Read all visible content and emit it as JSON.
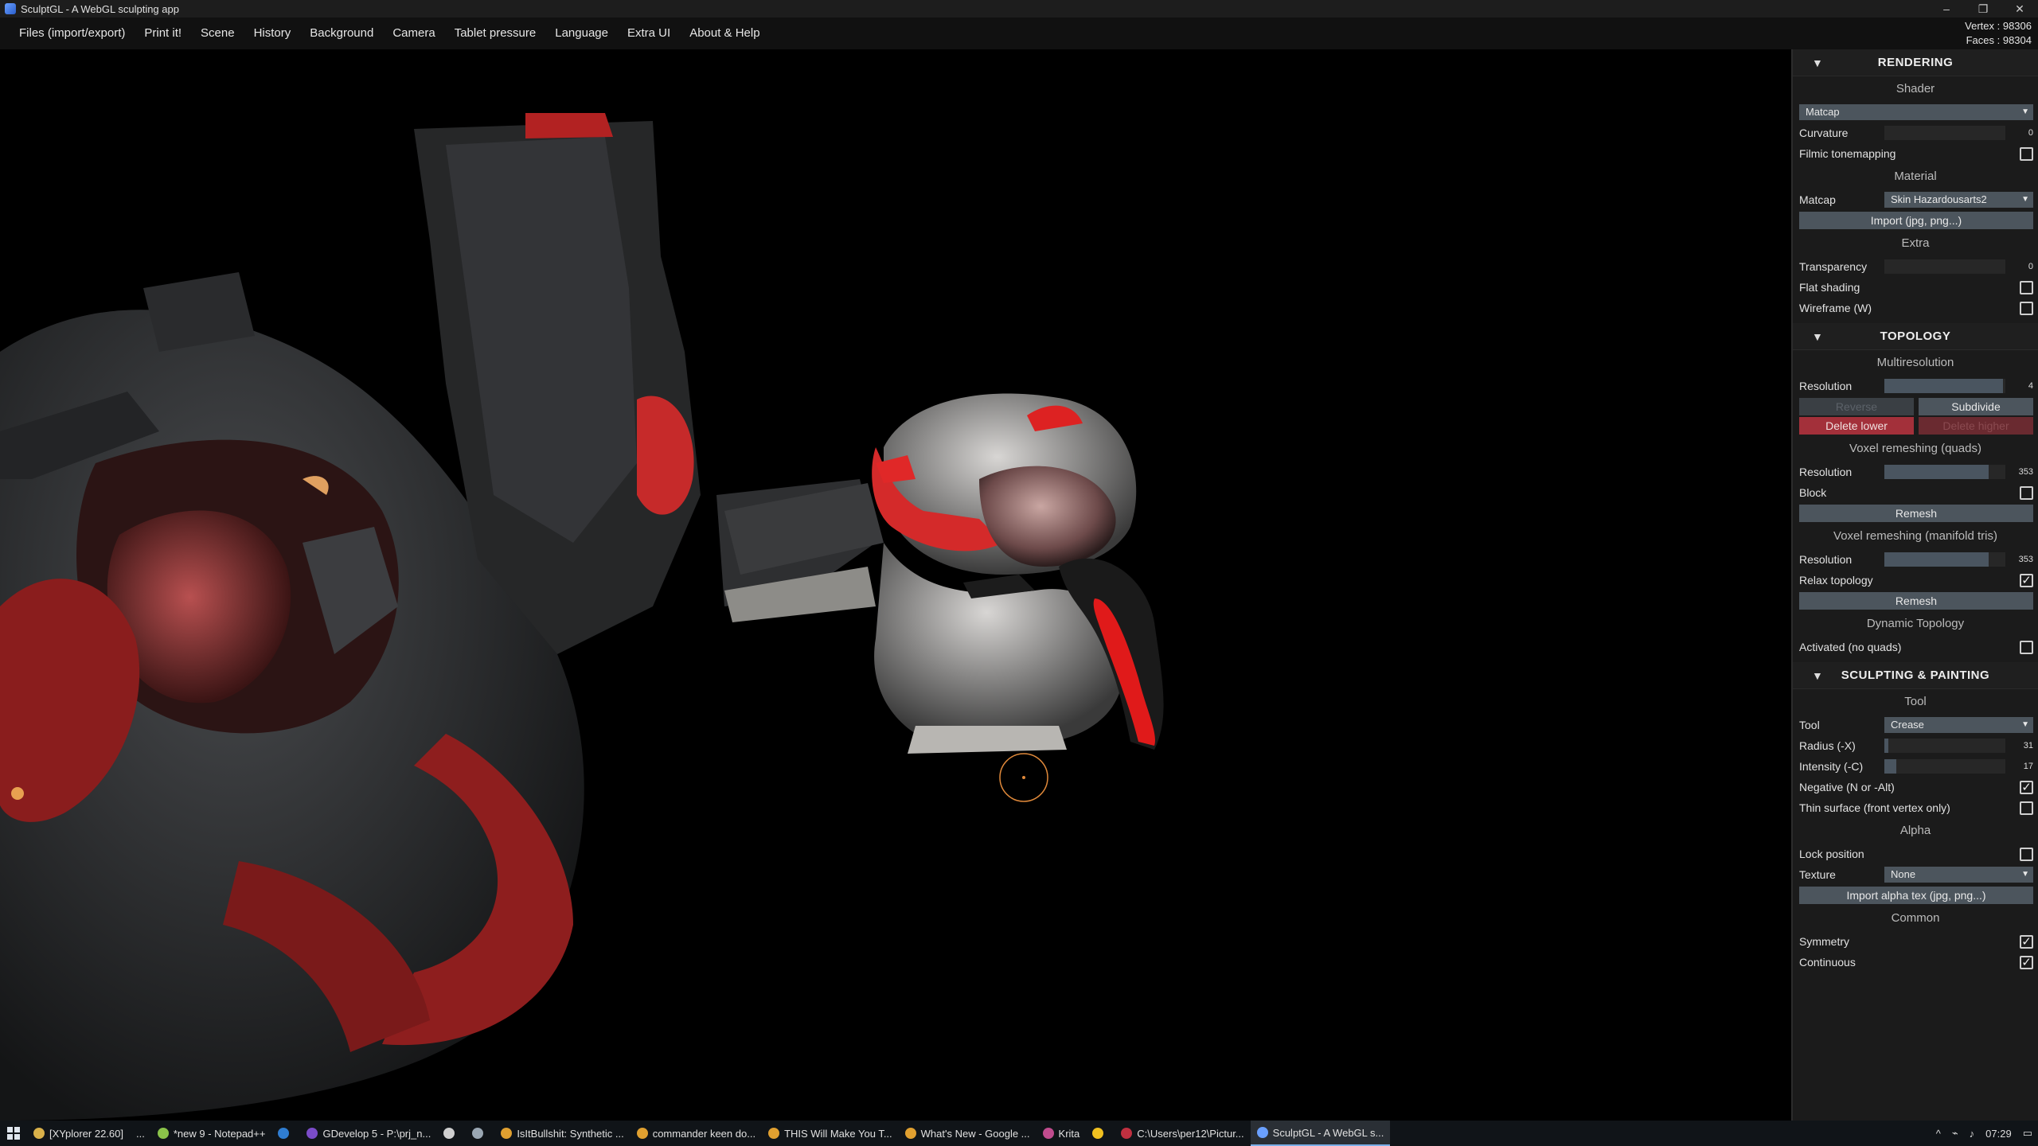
{
  "window": {
    "title": "SculptGL - A WebGL sculpting app",
    "minimize": "–",
    "restore": "❐",
    "close": "✕"
  },
  "menubar": {
    "items": [
      "Files (import/export)",
      "Print it!",
      "Scene",
      "History",
      "Background",
      "Camera",
      "Tablet pressure",
      "Language",
      "Extra UI",
      "About & Help"
    ]
  },
  "stats": {
    "vertex": "Vertex : 98306",
    "faces": "Faces : 98304"
  },
  "panel": {
    "rendering": {
      "title": "RENDERING",
      "shader_title": "Shader",
      "shader_value": "Matcap",
      "curvature_label": "Curvature",
      "curvature_value": "0",
      "curvature_level": 0,
      "filmic_label": "Filmic tonemapping",
      "filmic_checked": false,
      "material_title": "Material",
      "matcap_label": "Matcap",
      "matcap_value": "Skin Hazardousarts2",
      "import_label": "Import (jpg, png...)",
      "extra_title": "Extra",
      "transparency_label": "Transparency",
      "transparency_value": "0",
      "transparency_level": 0,
      "flat_label": "Flat shading",
      "flat_checked": false,
      "wireframe_label": "Wireframe (W)",
      "wireframe_checked": false
    },
    "topology": {
      "title": "TOPOLOGY",
      "multires_title": "Multiresolution",
      "resolution_label": "Resolution",
      "resolution_value": "4",
      "resolution_level": 0.98,
      "reverse_label": "Reverse",
      "subdivide_label": "Subdivide",
      "delete_lower_label": "Delete lower",
      "delete_higher_label": "Delete higher",
      "voxel_quads_title": "Voxel remeshing (quads)",
      "voxel_quads_res_label": "Resolution",
      "voxel_quads_res_value": "353",
      "voxel_quads_res_level": 0.86,
      "block_label": "Block",
      "block_checked": false,
      "remesh_label": "Remesh",
      "voxel_tris_title": "Voxel remeshing (manifold tris)",
      "voxel_tris_res_label": "Resolution",
      "voxel_tris_res_value": "353",
      "voxel_tris_res_level": 0.86,
      "relax_label": "Relax topology",
      "relax_checked": true,
      "remesh2_label": "Remesh",
      "dyntopo_title": "Dynamic Topology",
      "activated_label": "Activated (no quads)",
      "activated_checked": false
    },
    "sculpting": {
      "title": "SCULPTING & PAINTING",
      "tool_title": "Tool",
      "tool_label": "Tool",
      "tool_value": "Crease",
      "radius_label": "Radius (-X)",
      "radius_value": "31",
      "radius_level": 0.03,
      "intensity_label": "Intensity (-C)",
      "intensity_value": "17",
      "intensity_level": 0.1,
      "negative_label": "Negative (N or -Alt)",
      "negative_checked": true,
      "thin_label": "Thin surface (front vertex only)",
      "thin_checked": false,
      "alpha_title": "Alpha",
      "lock_label": "Lock position",
      "lock_checked": false,
      "texture_label": "Texture",
      "texture_value": "None",
      "import_alpha_label": "Import alpha tex (jpg, png...)",
      "common_title": "Common",
      "symmetry_label": "Symmetry",
      "symmetry_checked": true,
      "continuous_label": "Continuous",
      "continuous_checked": true
    }
  },
  "taskbar": {
    "items": [
      {
        "label": "[XYplorer 22.60]",
        "icon": "#d9b14a"
      },
      {
        "label": "...",
        "icon": ""
      },
      {
        "label": "*new 9 - Notepad++",
        "icon": "#8bc34a"
      },
      {
        "label": "",
        "icon": "#2f7dd1"
      },
      {
        "label": "GDevelop 5 - P:\\prj_n...",
        "icon": "#7b4cc9"
      },
      {
        "label": "",
        "icon": "#cfcfcf"
      },
      {
        "label": "",
        "icon": "#9aa7b3"
      },
      {
        "label": "IsItBullshit: Synthetic ...",
        "icon": "#e0a030"
      },
      {
        "label": "commander keen do...",
        "icon": "#e0a030"
      },
      {
        "label": "THIS Will Make You T...",
        "icon": "#e0a030"
      },
      {
        "label": "What's New - Google ...",
        "icon": "#e0a030"
      },
      {
        "label": "Krita",
        "icon": "#c04c8e"
      },
      {
        "label": "",
        "icon": "#f0c020"
      },
      {
        "label": "C:\\Users\\per12\\Pictur...",
        "icon": "#c03040"
      },
      {
        "label": "SculptGL - A WebGL s...",
        "icon": "#6aa0ff",
        "active": true
      }
    ],
    "tray_time": "07:29",
    "tray_up": "^"
  }
}
